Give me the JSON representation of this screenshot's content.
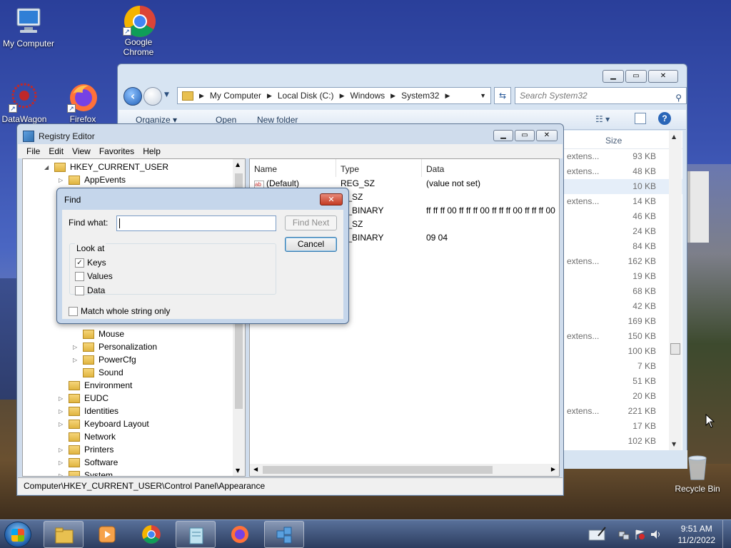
{
  "desktop": {
    "icons": [
      {
        "label": "My Computer"
      },
      {
        "label": "Google\nChrome"
      },
      {
        "label": "DataWagon"
      },
      {
        "label": "Firefox"
      },
      {
        "label": "Recycle Bin"
      }
    ]
  },
  "explorer": {
    "breadcrumb": [
      "My Computer",
      "Local Disk (C:)",
      "Windows",
      "System32"
    ],
    "search_placeholder": "Search System32",
    "toolbar": {
      "organize": "Organize ▾",
      "open": "Open",
      "new_folder": "New folder"
    },
    "column_size": "Size",
    "rows": [
      {
        "ext": "extens...",
        "size": "93 KB"
      },
      {
        "ext": "extens...",
        "size": "48 KB"
      },
      {
        "ext": "",
        "size": "10 KB",
        "selected": true
      },
      {
        "ext": "extens...",
        "size": "14 KB"
      },
      {
        "ext": "",
        "size": "46 KB"
      },
      {
        "ext": "",
        "size": "24 KB"
      },
      {
        "ext": "",
        "size": "84 KB"
      },
      {
        "ext": "extens...",
        "size": "162 KB"
      },
      {
        "ext": "",
        "size": "19 KB"
      },
      {
        "ext": "",
        "size": "68 KB"
      },
      {
        "ext": "",
        "size": "42 KB"
      },
      {
        "ext": "",
        "size": "169 KB"
      },
      {
        "ext": "extens...",
        "size": "150 KB"
      },
      {
        "ext": "",
        "size": "100 KB"
      },
      {
        "ext": "",
        "size": "7 KB"
      },
      {
        "ext": "",
        "size": "51 KB"
      },
      {
        "ext": "",
        "size": "20 KB"
      },
      {
        "ext": "extens...",
        "size": "221 KB"
      },
      {
        "ext": "",
        "size": "17 KB"
      },
      {
        "ext": "",
        "size": "102 KB"
      }
    ]
  },
  "regedit": {
    "title": "Registry Editor",
    "menu": [
      "File",
      "Edit",
      "View",
      "Favorites",
      "Help"
    ],
    "tree": [
      {
        "label": "HKEY_CURRENT_USER",
        "expander": "◢"
      },
      {
        "label": "AppEvents",
        "expander": "▷"
      },
      {
        "label": "Mouse",
        "expander": ""
      },
      {
        "label": "Personalization",
        "expander": "▷"
      },
      {
        "label": "PowerCfg",
        "expander": "▷"
      },
      {
        "label": "Sound",
        "expander": ""
      },
      {
        "label": "Environment",
        "expander": ""
      },
      {
        "label": "EUDC",
        "expander": "▷"
      },
      {
        "label": "Identities",
        "expander": "▷"
      },
      {
        "label": "Keyboard Layout",
        "expander": "▷"
      },
      {
        "label": "Network",
        "expander": ""
      },
      {
        "label": "Printers",
        "expander": "▷"
      },
      {
        "label": "Software",
        "expander": "▷"
      },
      {
        "label": "System",
        "expander": "▷"
      }
    ],
    "columns": {
      "name": "Name",
      "type": "Type",
      "data": "Data"
    },
    "values": [
      {
        "name": "(Default)",
        "type": "REG_SZ",
        "data": "(value not set)"
      },
      {
        "name": "",
        "type": "G_SZ",
        "data": ""
      },
      {
        "name": "",
        "type": "G_BINARY",
        "data": "ff ff ff 00 ff ff ff 00 ff ff ff 00 ff ff ff 00"
      },
      {
        "name": "",
        "type": "G_SZ",
        "data": ""
      },
      {
        "name": "",
        "type": "G_BINARY",
        "data": "09 04"
      }
    ],
    "status": "Computer\\HKEY_CURRENT_USER\\Control Panel\\Appearance"
  },
  "find": {
    "title": "Find",
    "find_what_label": "Find what:",
    "find_what_value": "",
    "find_next": "Find Next",
    "cancel": "Cancel",
    "look_at": "Look at",
    "options": [
      {
        "label": "Keys",
        "checked": true
      },
      {
        "label": "Values",
        "checked": false
      },
      {
        "label": "Data",
        "checked": false
      }
    ],
    "match_whole": {
      "label": "Match whole string only",
      "checked": false
    }
  },
  "taskbar": {
    "time": "9:51 AM",
    "date": "11/2/2022"
  }
}
